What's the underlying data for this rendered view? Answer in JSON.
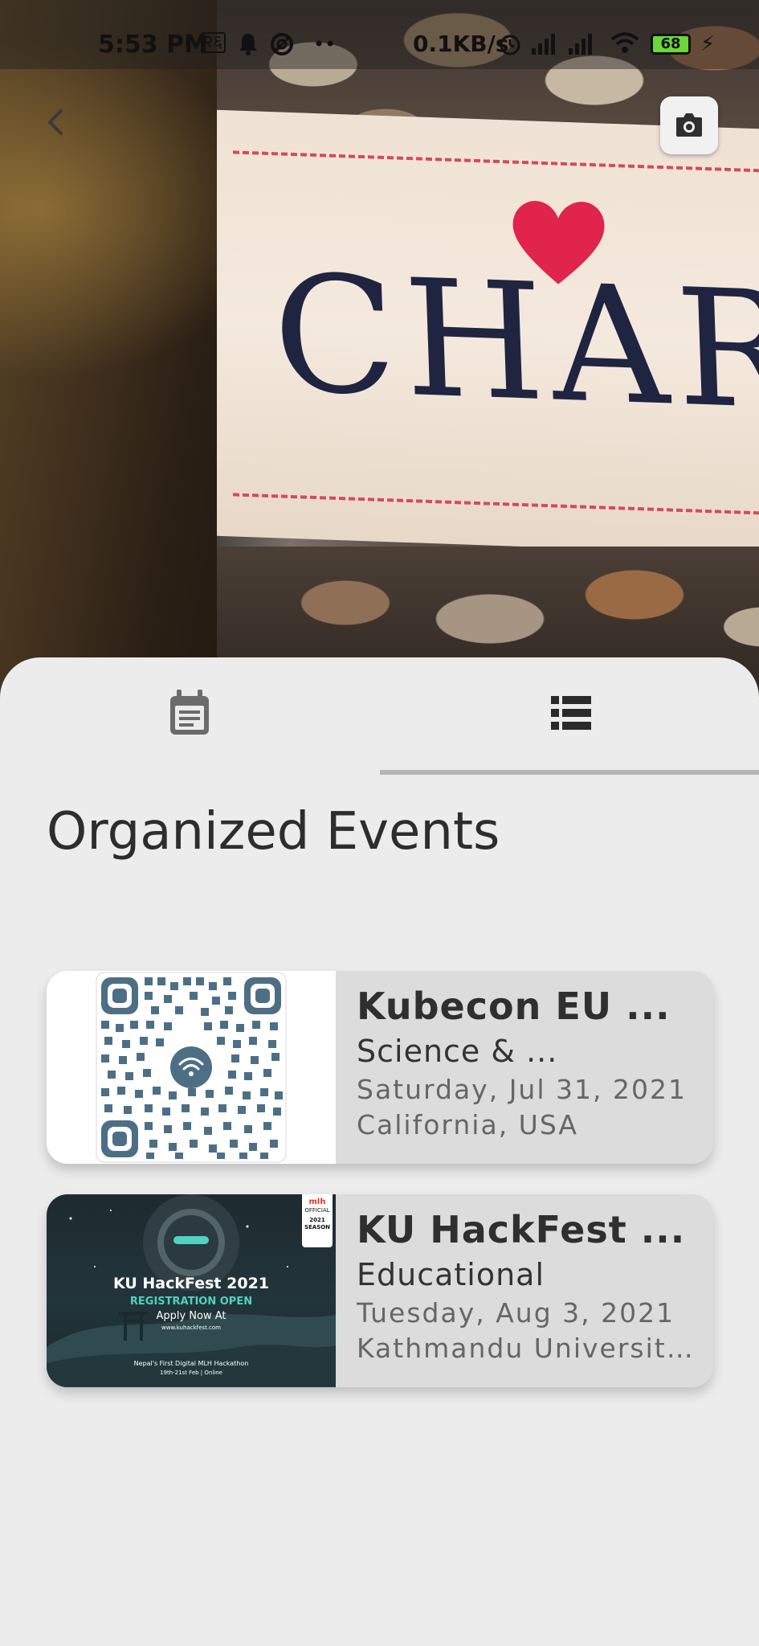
{
  "status_bar": {
    "time": "5:53 PM",
    "net_speed": "0.1KB/s",
    "battery": "68",
    "carrier_glyph": "२६"
  },
  "hero": {
    "label_text": "CHARITY",
    "back_icon": "chevron-left-icon",
    "camera_icon": "camera-icon"
  },
  "tabs": [
    {
      "icon": "calendar-icon",
      "selected": false
    },
    {
      "icon": "list-icon",
      "selected": true
    }
  ],
  "section": {
    "title": "Organized Events"
  },
  "events": [
    {
      "name": "Kubecon EU ...",
      "category": "Science & ...",
      "date": "Saturday, Jul 31, 2021",
      "location": "California, USA",
      "thumbnail": "qr-code"
    },
    {
      "name": "KU HackFest ...",
      "category": "Educational",
      "date": "Tuesday, Aug 3, 2021",
      "location": "Kathmandu University...",
      "thumbnail": "hackfest-poster",
      "poster": {
        "title": "KU HackFest 2021",
        "registration": "REGISTRATION OPEN",
        "apply": "Apply Now At",
        "url": "www.kuhackfest.com",
        "subtitle": "Nepal's First Digital MLH Hackathon",
        "dates": "19th-21st Feb | Online",
        "badge_top": "mlh",
        "badge_mid": "OFFICIAL",
        "badge_bottom": "2021 SEASON"
      }
    }
  ],
  "colors": {
    "sheet_bg": "#ececec",
    "card_bg": "#dcdcdc",
    "tab_indicator": "#b5b5b5",
    "title_text": "#2d2d2d"
  }
}
